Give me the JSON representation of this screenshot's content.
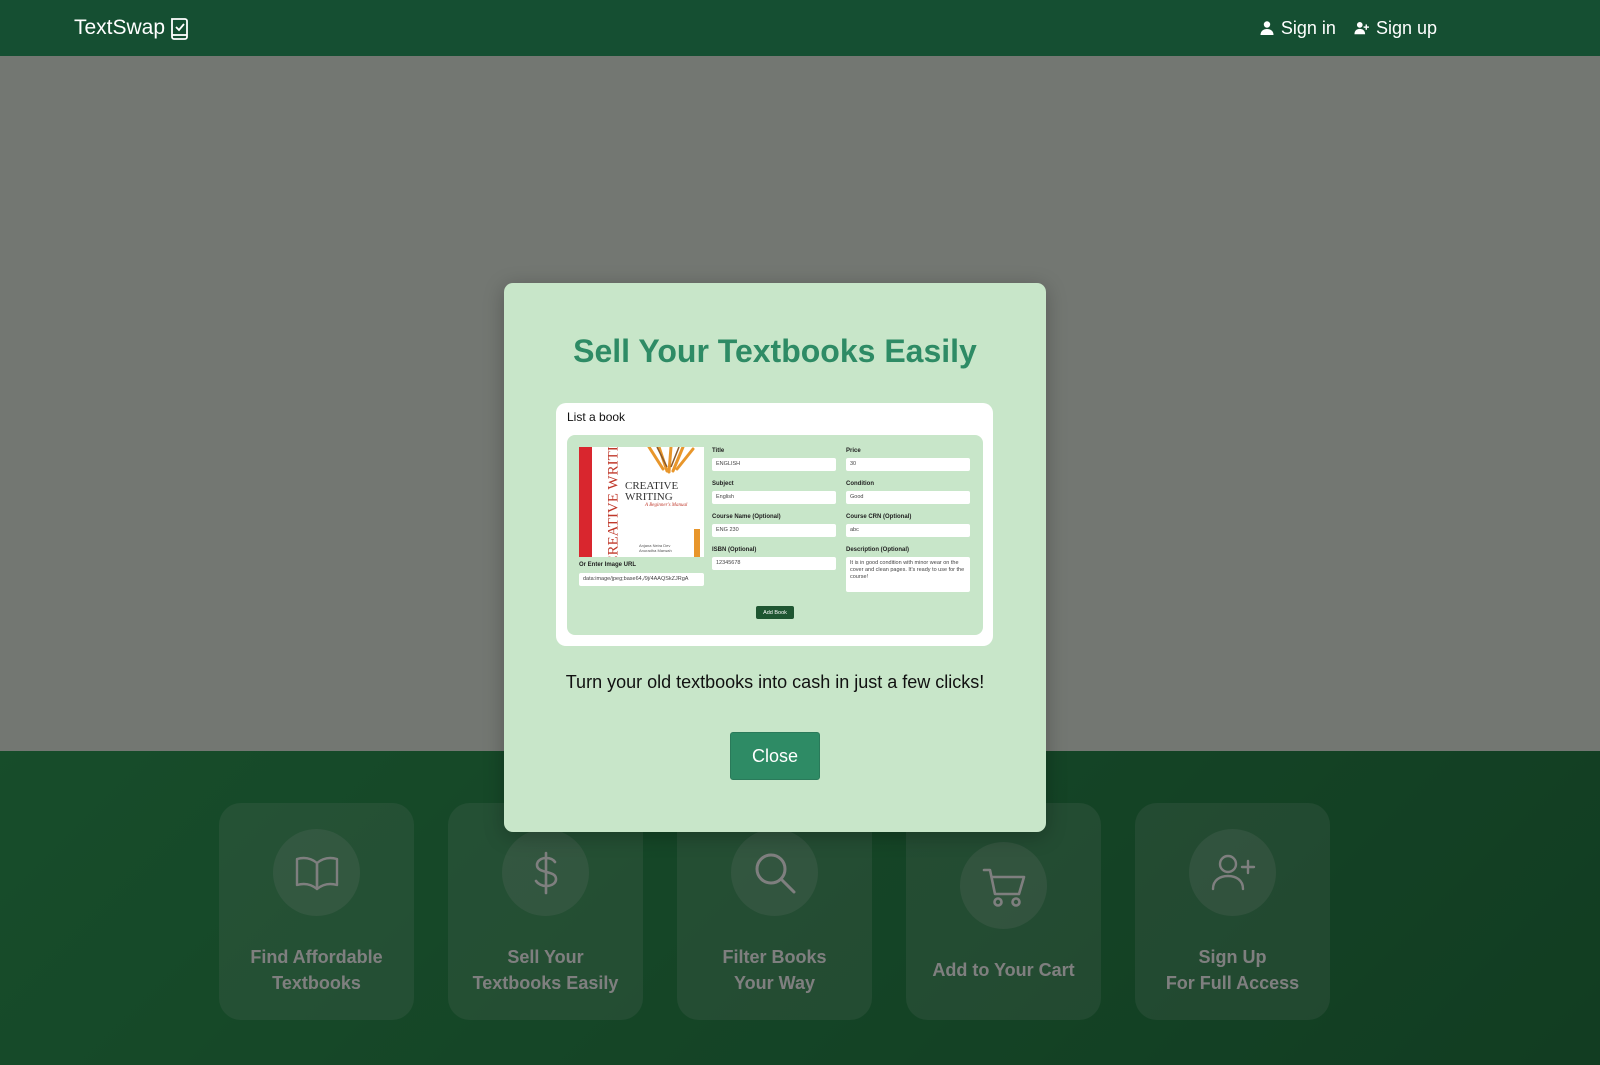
{
  "navbar": {
    "brand": "TextSwap",
    "sign_in": "Sign in",
    "sign_up": "Sign up"
  },
  "features": [
    {
      "icon": "book-open-icon",
      "line1": "Find Affordable",
      "line2": "Textbooks"
    },
    {
      "icon": "dollar-icon",
      "line1": "Sell Your",
      "line2": "Textbooks Easily"
    },
    {
      "icon": "search-icon",
      "line1": "Filter Books",
      "line2": "Your Way"
    },
    {
      "icon": "cart-icon",
      "line1": "Add to Your Cart",
      "line2": ""
    },
    {
      "icon": "user-plus-icon",
      "line1": "Sign Up",
      "line2": "For Full Access"
    }
  ],
  "modal": {
    "title": "Sell Your Textbooks Easily",
    "description": "Turn your old textbooks into cash in just a few clicks!",
    "close_label": "Close"
  },
  "preview": {
    "heading": "List a book",
    "cover_vertical": "CREATIVE WRITIN",
    "cover_title_line1": "CREATIVE",
    "cover_title_line2": "WRITING",
    "cover_subtitle": "A Beginner's Manual",
    "cover_author1": "Anjana Neira Dev",
    "cover_author2": "Anuradha Marwah",
    "image_url_label": "Or Enter Image URL",
    "image_url_value": "data:image/jpeg;base64,/9j/4AAQSkZJRgA",
    "fields": {
      "title_label": "Title",
      "title_value": "ENGLISH",
      "price_label": "Price",
      "price_value": "30",
      "subject_label": "Subject",
      "subject_value": "English",
      "condition_label": "Condition",
      "condition_value": "Good",
      "course_name_label": "Course Name (Optional)",
      "course_name_value": "ENG 230",
      "course_crn_label": "Course CRN (Optional)",
      "course_crn_value": "abc",
      "isbn_label": "ISBN (Optional)",
      "isbn_value": "12345678",
      "description_label": "Description (Optional)",
      "description_value": "It is in good condition with minor wear on the cover and clean pages. It's ready to use for the course!"
    },
    "add_book_label": "Add Book"
  },
  "colors": {
    "navbar": "#154f32",
    "modal_bg": "#c8e6c9",
    "accent": "#2e8b65",
    "features_bg": "#2a8a4d"
  }
}
